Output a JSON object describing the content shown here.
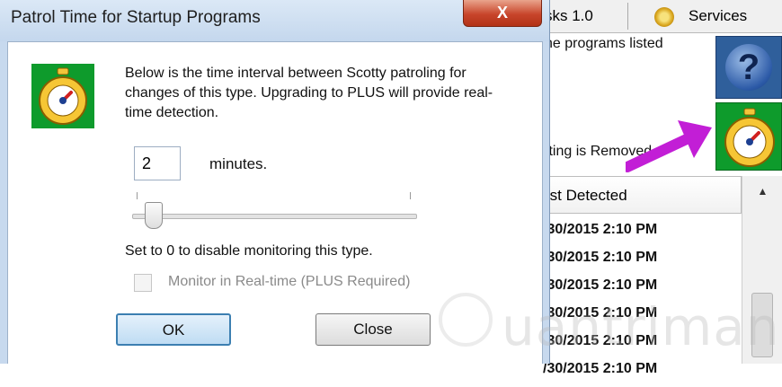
{
  "dialog": {
    "title": "Patrol Time for Startup Programs",
    "close_glyph": "X",
    "description": "Below is the time interval between Scotty patroling for changes of this type. Upgrading to PLUS will provide real-time detection.",
    "minutes_value": "2",
    "minutes_label": "minutes.",
    "slider_value_minutes": 2,
    "disable_note": "Set to 0 to disable monitoring this type.",
    "realtime_checkbox_label": "Monitor in Real-time (PLUS Required)",
    "realtime_checked": false,
    "ok_label": "OK",
    "close_label": "Close",
    "icon": "stopwatch-icon"
  },
  "background": {
    "tab_tasks": "sks 1.0",
    "tab_services": "Services",
    "description_fragment": "he programs listed",
    "removed_fragment": "tting is Removed",
    "column_header": "rst Detected",
    "rows": [
      "/30/2015 2:10 PM",
      "/30/2015 2:10 PM",
      "/30/2015 2:10 PM",
      "/30/2015 2:10 PM",
      "/30/2015 2:10 PM",
      "/30/2015 2:10 PM"
    ],
    "help_glyph": "?",
    "arrow_color": "#c21ed6",
    "accent_green": "#0e9b2c"
  },
  "watermark": {
    "text": "uantrimang"
  }
}
